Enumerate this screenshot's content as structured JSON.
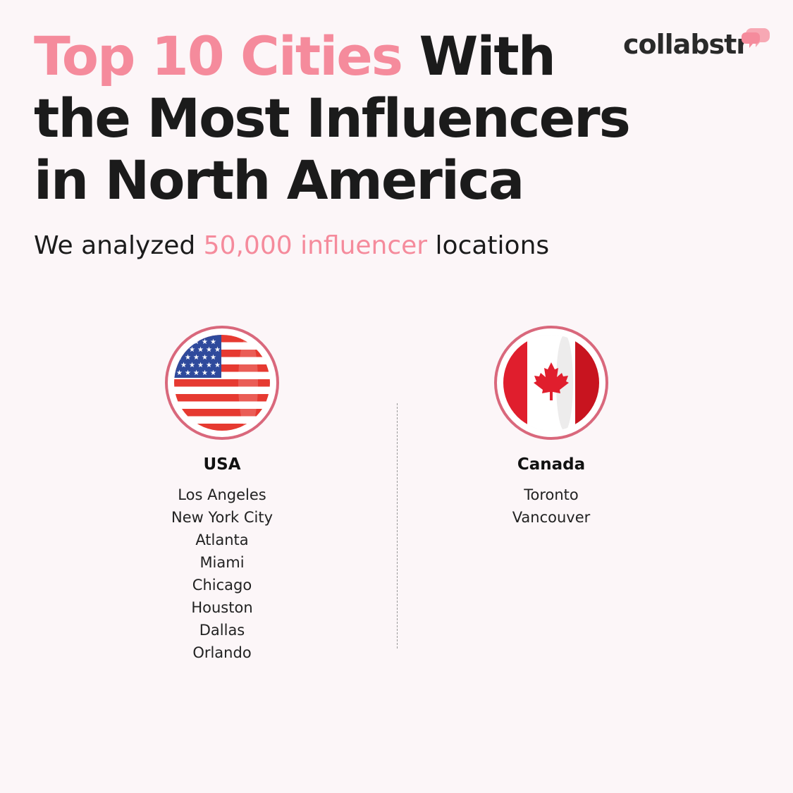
{
  "headline": {
    "highlight": "Top 10 Cities",
    "rest_line1": " With",
    "line2": "the Most Influencers",
    "line3": "in North America"
  },
  "subtitle": {
    "before": "We analyzed ",
    "highlight": "50,000 influencer",
    "after": " locations"
  },
  "logo": {
    "text": "collabstr",
    "icon": "speech-bubbles-icon"
  },
  "countries": [
    {
      "name": "USA",
      "flag_icon": "usa-flag-icon",
      "cities": [
        "Los Angeles",
        "New York City",
        "Atlanta",
        "Miami",
        "Chicago",
        "Houston",
        "Dallas",
        "Orlando"
      ]
    },
    {
      "name": "Canada",
      "flag_icon": "canada-flag-icon",
      "cities": [
        "Toronto",
        "Vancouver"
      ]
    }
  ],
  "colors": {
    "background": "#fcf6f8",
    "accent_pink": "#f58b9c",
    "flag_ring": "#d9687c",
    "us_red": "#e63a31",
    "us_blue": "#2f4a9c",
    "ca_red": "#e01e2d",
    "text_dark": "#1b1b1b"
  }
}
